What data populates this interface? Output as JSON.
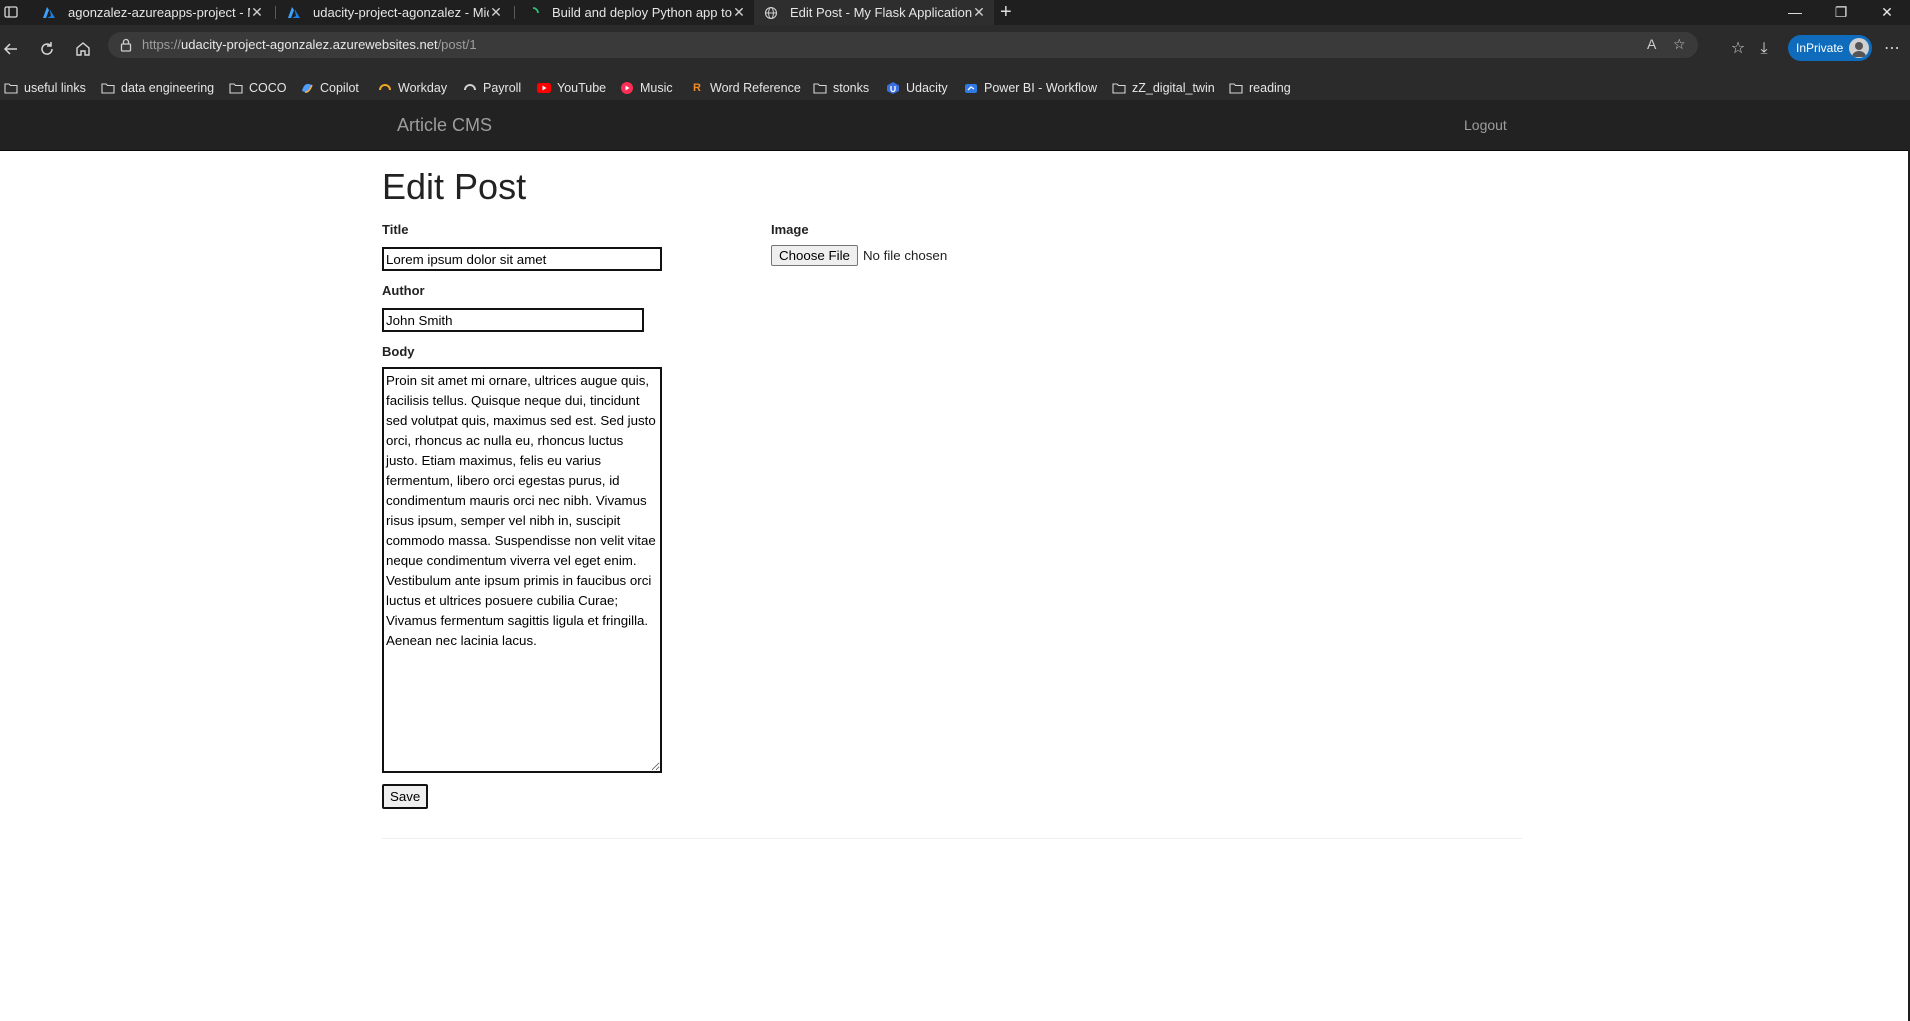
{
  "browser": {
    "tabs": [
      {
        "title": "agonzalez-azureapps-project - M",
        "icon": "azure-icon"
      },
      {
        "title": "udacity-project-agonzalez - Micro",
        "icon": "azure-icon"
      },
      {
        "title": "Build and deploy Python app to A",
        "icon": "loading-icon"
      },
      {
        "title": "Edit Post - My Flask Application",
        "icon": "globe-icon"
      }
    ],
    "url_prefix": "https://",
    "url_host": "udacity-project-agonzalez.azurewebsites.net",
    "url_path": "/post/1",
    "inprivate_label": "InPrivate",
    "bookmarks": [
      {
        "label": "useful links",
        "icon": "folder-icon"
      },
      {
        "label": "data engineering",
        "icon": "folder-icon"
      },
      {
        "label": "COCO",
        "icon": "folder-icon"
      },
      {
        "label": "Copilot",
        "icon": "copilot-icon"
      },
      {
        "label": "Workday",
        "icon": "workday-icon"
      },
      {
        "label": "Payroll",
        "icon": "payroll-icon"
      },
      {
        "label": "YouTube",
        "icon": "youtube-icon"
      },
      {
        "label": "Music",
        "icon": "music-icon"
      },
      {
        "label": "Word Reference",
        "icon": "wordreference-icon"
      },
      {
        "label": "stonks",
        "icon": "folder-icon"
      },
      {
        "label": "Udacity",
        "icon": "udacity-icon"
      },
      {
        "label": "Power BI - Workflow",
        "icon": "powerbi-icon"
      },
      {
        "label": "zZ_digital_twin",
        "icon": "folder-icon"
      },
      {
        "label": "reading",
        "icon": "folder-icon"
      }
    ]
  },
  "app": {
    "brand": "Article CMS",
    "logout": "Logout"
  },
  "form": {
    "heading": "Edit Post",
    "title_label": "Title",
    "title_value": "Lorem ipsum dolor sit amet",
    "author_label": "Author",
    "author_value": "John Smith",
    "body_label": "Body",
    "body_value": "Proin sit amet mi ornare, ultrices augue quis, facilisis tellus. Quisque neque dui, tincidunt sed volutpat quis, maximus sed est. Sed justo orci, rhoncus ac nulla eu, rhoncus luctus justo. Etiam maximus, felis eu varius fermentum, libero orci egestas purus, id condimentum mauris orci nec nibh. Vivamus risus ipsum, semper vel nibh in, suscipit commodo massa. Suspendisse non velit vitae neque condimentum viverra vel eget enim. Vestibulum ante ipsum primis in faucibus orci luctus et ultrices posuere cubilia Curae; Vivamus fermentum sagittis ligula et fringilla. Aenean nec lacinia lacus.",
    "image_label": "Image",
    "choose_file": "Choose File",
    "no_file": "No file chosen",
    "save": "Save"
  },
  "colors": {
    "navbar": "#222222",
    "brand_text": "#9d9d9d",
    "inprivate": "#0f6cbd"
  }
}
